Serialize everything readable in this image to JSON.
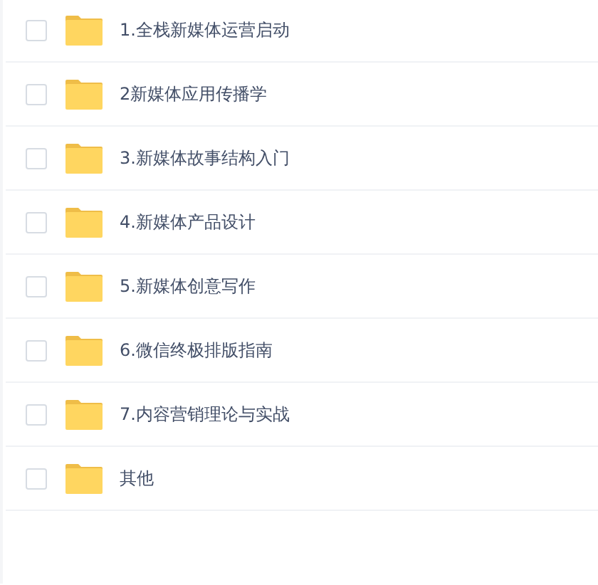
{
  "files": [
    {
      "name": "1.全栈新媒体运营启动",
      "checked": false
    },
    {
      "name": "2新媒体应用传播学",
      "checked": false
    },
    {
      "name": "3.新媒体故事结构入门",
      "checked": false
    },
    {
      "name": "4.新媒体产品设计",
      "checked": false
    },
    {
      "name": "5.新媒体创意写作",
      "checked": false
    },
    {
      "name": "6.微信终极排版指南",
      "checked": false
    },
    {
      "name": "7.内容营销理论与实战",
      "checked": false
    },
    {
      "name": "其他",
      "checked": false
    }
  ]
}
